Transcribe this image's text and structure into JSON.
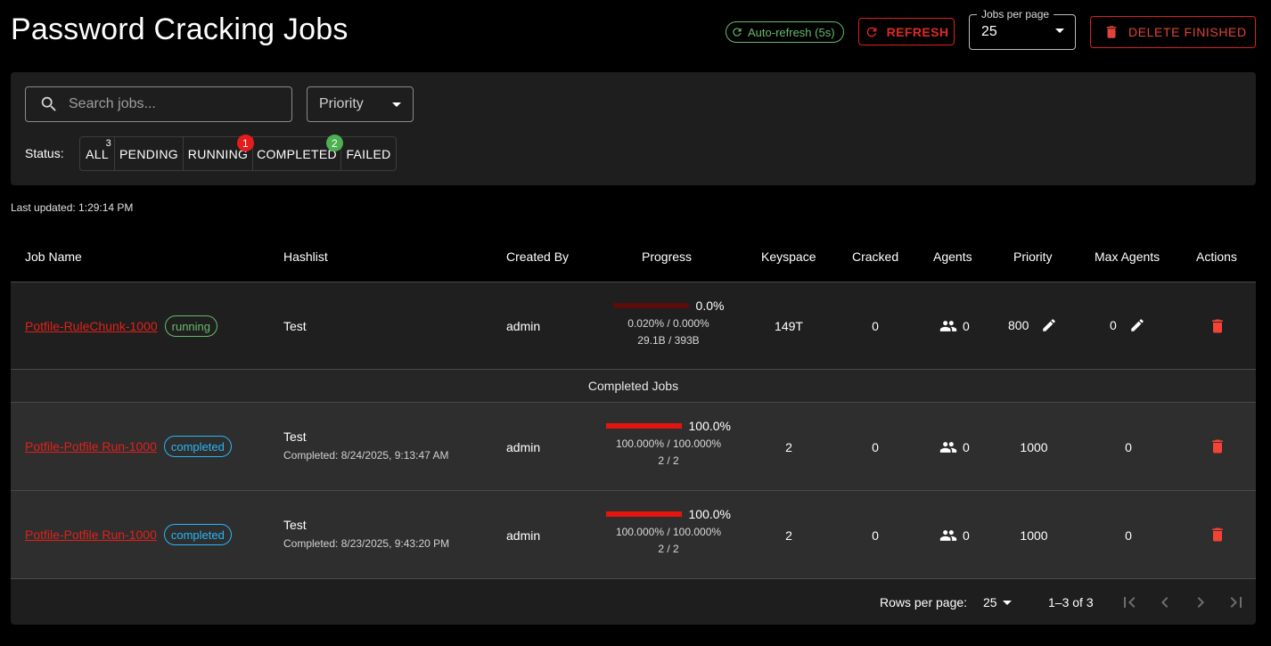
{
  "header": {
    "title": "Password Cracking Jobs",
    "auto_refresh_label": "Auto-refresh (5s)",
    "refresh_label": "REFRESH",
    "jobs_per_page_label": "Jobs per page",
    "jobs_per_page_value": "25",
    "delete_finished_label": "DELETE FINISHED"
  },
  "filters": {
    "search_placeholder": "Search jobs...",
    "priority_label": "Priority",
    "status_label": "Status:",
    "statuses": [
      {
        "label": "ALL",
        "badge": "3"
      },
      {
        "label": "PENDING",
        "badge": ""
      },
      {
        "label": "RUNNING",
        "badge": "1"
      },
      {
        "label": "COMPLETED",
        "badge": "2"
      },
      {
        "label": "FAILED",
        "badge": ""
      }
    ]
  },
  "last_updated": "Last updated: 1:29:14 PM",
  "table": {
    "columns": [
      "Job Name",
      "Hashlist",
      "Created By",
      "Progress",
      "Keyspace",
      "Cracked",
      "Agents",
      "Priority",
      "Max Agents",
      "Actions"
    ],
    "section_completed": "Completed Jobs",
    "rows": [
      {
        "name": "Potfile-RuleChunk-1000",
        "status": "running",
        "hashlist": "Test",
        "completed_at": "",
        "created_by": "admin",
        "progress_pct": "0.0%",
        "progress_value": 0.0,
        "progress_detail": "0.020% / 0.000%",
        "progress_count": "29.1B / 393B",
        "keyspace": "149T",
        "cracked": "0",
        "agents": "0",
        "priority": "800",
        "max_agents": "0"
      },
      {
        "name": "Potfile-Potfile Run-1000",
        "status": "completed",
        "hashlist": "Test",
        "completed_at": "Completed: 8/24/2025, 9:13:47 AM",
        "created_by": "admin",
        "progress_pct": "100.0%",
        "progress_value": 100.0,
        "progress_detail": "100.000% / 100.000%",
        "progress_count": "2 / 2",
        "keyspace": "2",
        "cracked": "0",
        "agents": "0",
        "priority": "1000",
        "max_agents": "0"
      },
      {
        "name": "Potfile-Potfile Run-1000",
        "status": "completed",
        "hashlist": "Test",
        "completed_at": "Completed: 8/23/2025, 9:43:20 PM",
        "created_by": "admin",
        "progress_pct": "100.0%",
        "progress_value": 100.0,
        "progress_detail": "100.000% / 100.000%",
        "progress_count": "2 / 2",
        "keyspace": "2",
        "cracked": "0",
        "agents": "0",
        "priority": "1000",
        "max_agents": "0"
      }
    ]
  },
  "pagination": {
    "rows_per_page_label": "Rows per page:",
    "rows_per_page_value": "25",
    "range": "1–3 of 3"
  },
  "colors": {
    "accent_red": "#e0201a",
    "running_green": "#66bb6a",
    "completed_blue": "#29b6f6",
    "badge_red": "#e51c1c",
    "badge_green": "#4caf50"
  },
  "icons": [
    "refresh-icon",
    "delete-icon",
    "search-icon",
    "group-icon",
    "edit-icon",
    "first-page-icon",
    "prev-page-icon",
    "next-page-icon",
    "last-page-icon"
  ]
}
